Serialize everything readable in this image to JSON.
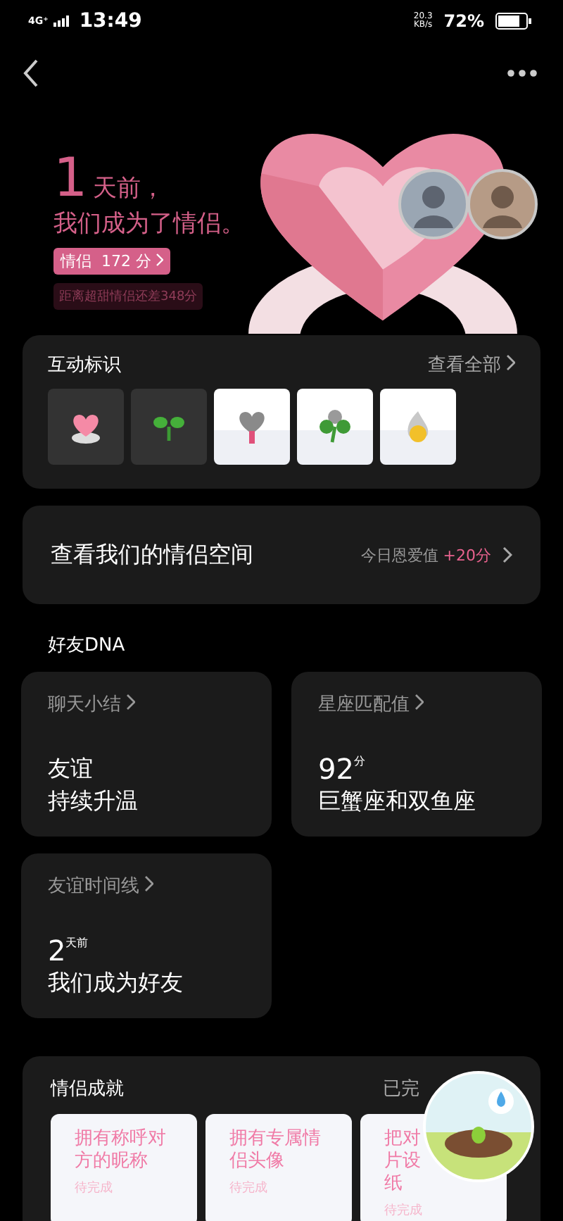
{
  "status_bar": {
    "network": "4G⁺",
    "time": "13:49",
    "speed": "20.3",
    "speed_unit": "KB/s",
    "battery": "72%"
  },
  "hero": {
    "number": "1",
    "days_suffix": "天前，",
    "headline": "我们成为了情侣。",
    "level_label": "情侣",
    "score": "172 分",
    "hint": "距离超甜情侣还差348分"
  },
  "badges": {
    "title": "互动标识",
    "link": "查看全部",
    "items": [
      {
        "kind": "dark"
      },
      {
        "kind": "dark"
      },
      {
        "kind": "light"
      },
      {
        "kind": "light"
      },
      {
        "kind": "light"
      }
    ]
  },
  "space": {
    "title": "查看我们的情侣空间",
    "today_label": "今日恩爱值",
    "today_value": "+20分"
  },
  "dna": {
    "title": "好友DNA",
    "cards": [
      {
        "label": "聊天小结",
        "lines": [
          "友谊",
          "持续升温"
        ]
      },
      {
        "label": "星座匹配值",
        "big": "92",
        "unit": "分",
        "lines": [
          "巨蟹座和双鱼座"
        ]
      },
      {
        "label": "友谊时间线",
        "big": "2",
        "unit": "天前",
        "lines": [
          "我们成为好友"
        ]
      }
    ]
  },
  "achievements": {
    "title": "情侣成就",
    "status": "已完",
    "items": [
      {
        "lines": [
          "拥有称呼对",
          "方的昵称"
        ],
        "state": "待完成"
      },
      {
        "lines": [
          "拥有专属情",
          "侣头像"
        ],
        "state": "待完成"
      },
      {
        "lines": [
          "把对",
          "片设",
          "纸"
        ],
        "state": "待完成"
      }
    ]
  }
}
